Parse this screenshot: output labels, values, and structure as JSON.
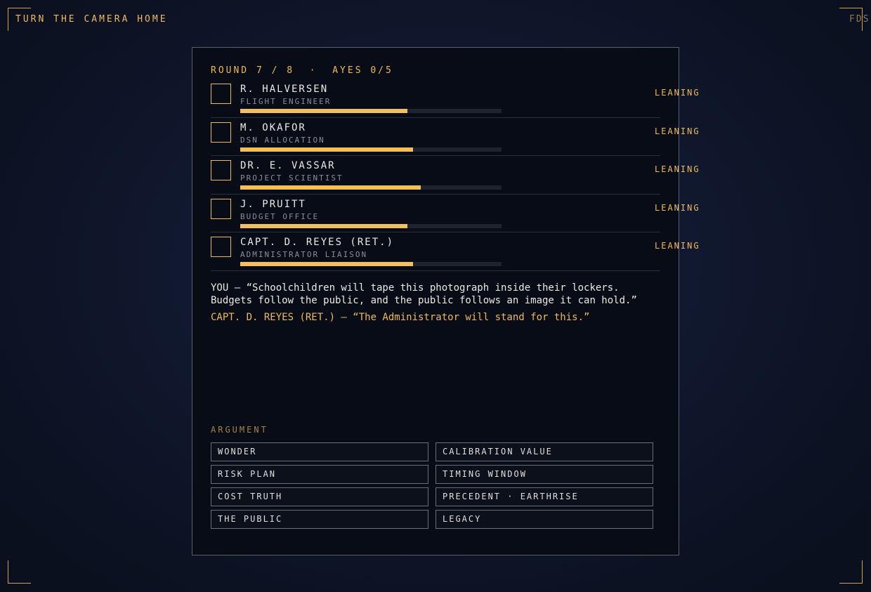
{
  "game": {
    "title": "TURN THE CAMERA HOME",
    "corner_tag": "FDS"
  },
  "status": {
    "round_text": "ROUND 7 / 8  ·  AYES 0/5"
  },
  "council": [
    {
      "name": "R. HALVERSEN",
      "role": "FLIGHT ENGINEER",
      "persuasion": 0.64,
      "status": "LEANING"
    },
    {
      "name": "M. OKAFOR",
      "role": "DSN ALLOCATION",
      "persuasion": 0.66,
      "status": "LEANING"
    },
    {
      "name": "DR. E. VASSAR",
      "role": "PROJECT SCIENTIST",
      "persuasion": 0.69,
      "status": "LEANING"
    },
    {
      "name": "J. PRUITT",
      "role": "BUDGET OFFICE",
      "persuasion": 0.64,
      "status": "LEANING"
    },
    {
      "name": "CAPT. D. REYES (RET.)",
      "role": "ADMINISTRATOR LIAISON",
      "persuasion": 0.66,
      "status": "LEANING"
    }
  ],
  "dialogue": {
    "you": "YOU — “Schoolchildren will tape this photograph inside their lockers. Budgets follow the public, and the public follows an image it can hold.”",
    "reply": "CAPT. D. REYES (RET.) — “The Administrator will stand for this.”"
  },
  "arguments": {
    "label": "ARGUMENT",
    "options": [
      "WONDER",
      "CALIBRATION VALUE",
      "RISK PLAN",
      "TIMING WINDOW",
      "COST TRUTH",
      "PRECEDENT · EARTHRISE",
      "THE PUBLIC",
      "LEGACY"
    ]
  },
  "colors": {
    "accent": "#f0b95a",
    "bar_fill": "#f5be5c",
    "panel_bg": "#080c16"
  }
}
